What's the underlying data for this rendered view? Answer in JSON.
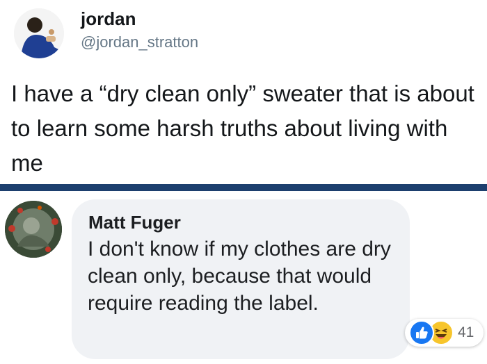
{
  "tweet": {
    "display_name": "jordan",
    "handle": "@jordan_stratton",
    "text": "I have a “dry clean only” sweater that is about to learn some harsh truths about living with me"
  },
  "comment": {
    "author": "Matt Fuger",
    "text": "I don't know if my clothes are dry clean only, because that would require reading the label.",
    "reactions": {
      "icons": [
        "like-icon",
        "haha-icon"
      ],
      "count": "41"
    }
  },
  "colors": {
    "divider": "#1d3f6e",
    "bubble": "#f0f2f5",
    "like": "#1877f2",
    "haha": "#f7c52c",
    "handle": "#657786"
  }
}
